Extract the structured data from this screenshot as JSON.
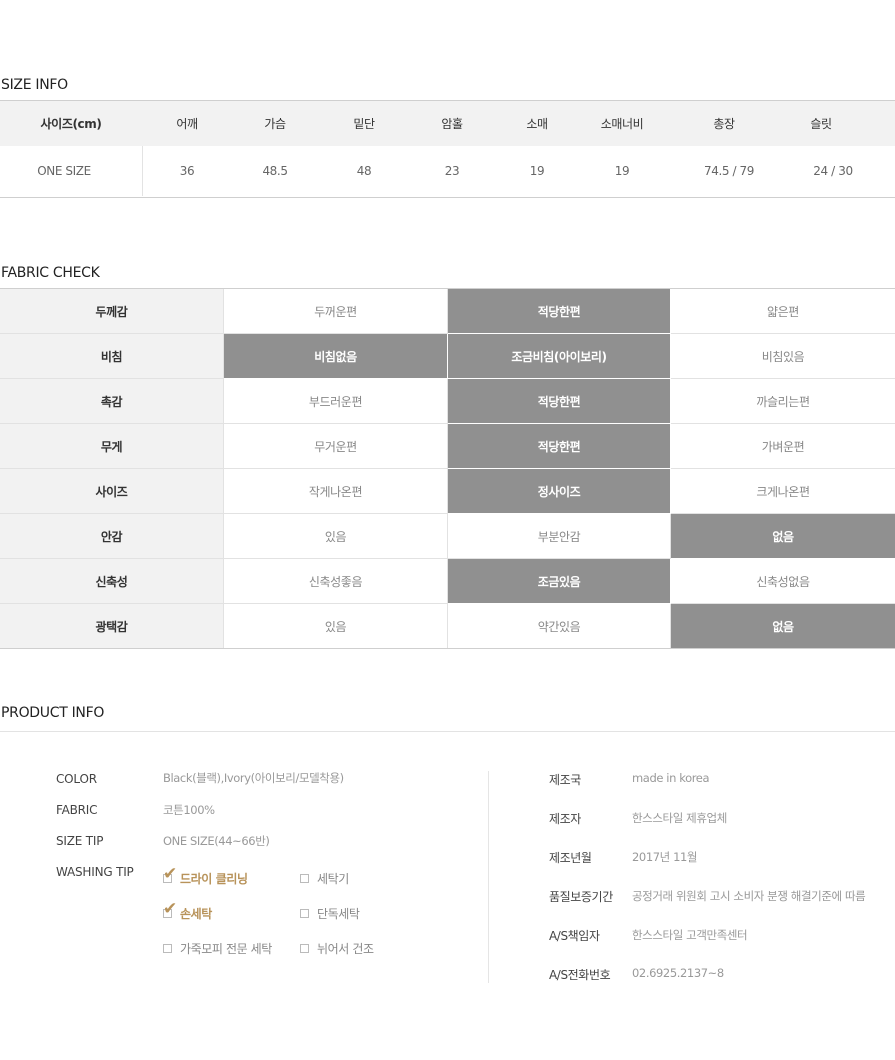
{
  "size_info": {
    "title": "SIZE INFO",
    "headers": [
      "사이즈(cm)",
      "어깨",
      "가슴",
      "밑단",
      "암홀",
      "소매",
      "소매너비",
      "총장",
      "슬릿"
    ],
    "row": [
      "ONE SIZE",
      "36",
      "48.5",
      "48",
      "23",
      "19",
      "19",
      "74.5 / 79",
      "24 / 30"
    ]
  },
  "fabric_check": {
    "title": "FABRIC CHECK",
    "rows": [
      {
        "label": "두께감",
        "options": [
          "두꺼운편",
          "적당한편",
          "얇은편"
        ],
        "selected": [
          1
        ]
      },
      {
        "label": "비침",
        "options": [
          "비침없음",
          "조금비침(아이보리)",
          "비침있음"
        ],
        "selected": [
          0,
          1
        ]
      },
      {
        "label": "촉감",
        "options": [
          "부드러운편",
          "적당한편",
          "까슬리는편"
        ],
        "selected": [
          1
        ]
      },
      {
        "label": "무게",
        "options": [
          "무거운편",
          "적당한편",
          "가벼운편"
        ],
        "selected": [
          1
        ]
      },
      {
        "label": "사이즈",
        "options": [
          "작게나온편",
          "정사이즈",
          "크게나온편"
        ],
        "selected": [
          1
        ]
      },
      {
        "label": "안감",
        "options": [
          "있음",
          "부분안감",
          "없음"
        ],
        "selected": [
          2
        ]
      },
      {
        "label": "신축성",
        "options": [
          "신축성좋음",
          "조금있음",
          "신축성없음"
        ],
        "selected": [
          1
        ]
      },
      {
        "label": "광택감",
        "options": [
          "있음",
          "약간있음",
          "없음"
        ],
        "selected": [
          2
        ]
      }
    ]
  },
  "product_info": {
    "title": "PRODUCT INFO",
    "left": {
      "color_label": "COLOR",
      "color_value": "Black(블랙),Ivory(아이보리/모델착용)",
      "fabric_label": "FABRIC",
      "fabric_value": "코튼100%",
      "size_tip_label": "SIZE TIP",
      "size_tip_value": "ONE SIZE(44~66반)",
      "washing_tip_label": "WASHING TIP",
      "washing": [
        {
          "label": "드라이 클리닝",
          "checked": true
        },
        {
          "label": "세탁기",
          "checked": false
        },
        {
          "label": "손세탁",
          "checked": true
        },
        {
          "label": "단독세탁",
          "checked": false
        },
        {
          "label": "가죽모피 전문 세탁",
          "checked": false
        },
        {
          "label": "뉘어서 건조",
          "checked": false
        }
      ]
    },
    "right": [
      {
        "label": "제조국",
        "value": "made in korea"
      },
      {
        "label": "제조자",
        "value": "한스스타일 제휴업체"
      },
      {
        "label": "제조년월",
        "value": "2017년 11월"
      },
      {
        "label": "품질보증기간",
        "value": "공정거래 위원회 고시 소비자 분쟁 해결기준에 따름"
      },
      {
        "label": "A/S책임자",
        "value": "한스스타일 고객만족센터"
      },
      {
        "label": "A/S전화번호",
        "value": "02.6925.2137~8"
      }
    ]
  },
  "colors": {
    "selected_fill": "#909090",
    "header_fill": "#f2f2f2",
    "check_accent": "#b8935a"
  }
}
